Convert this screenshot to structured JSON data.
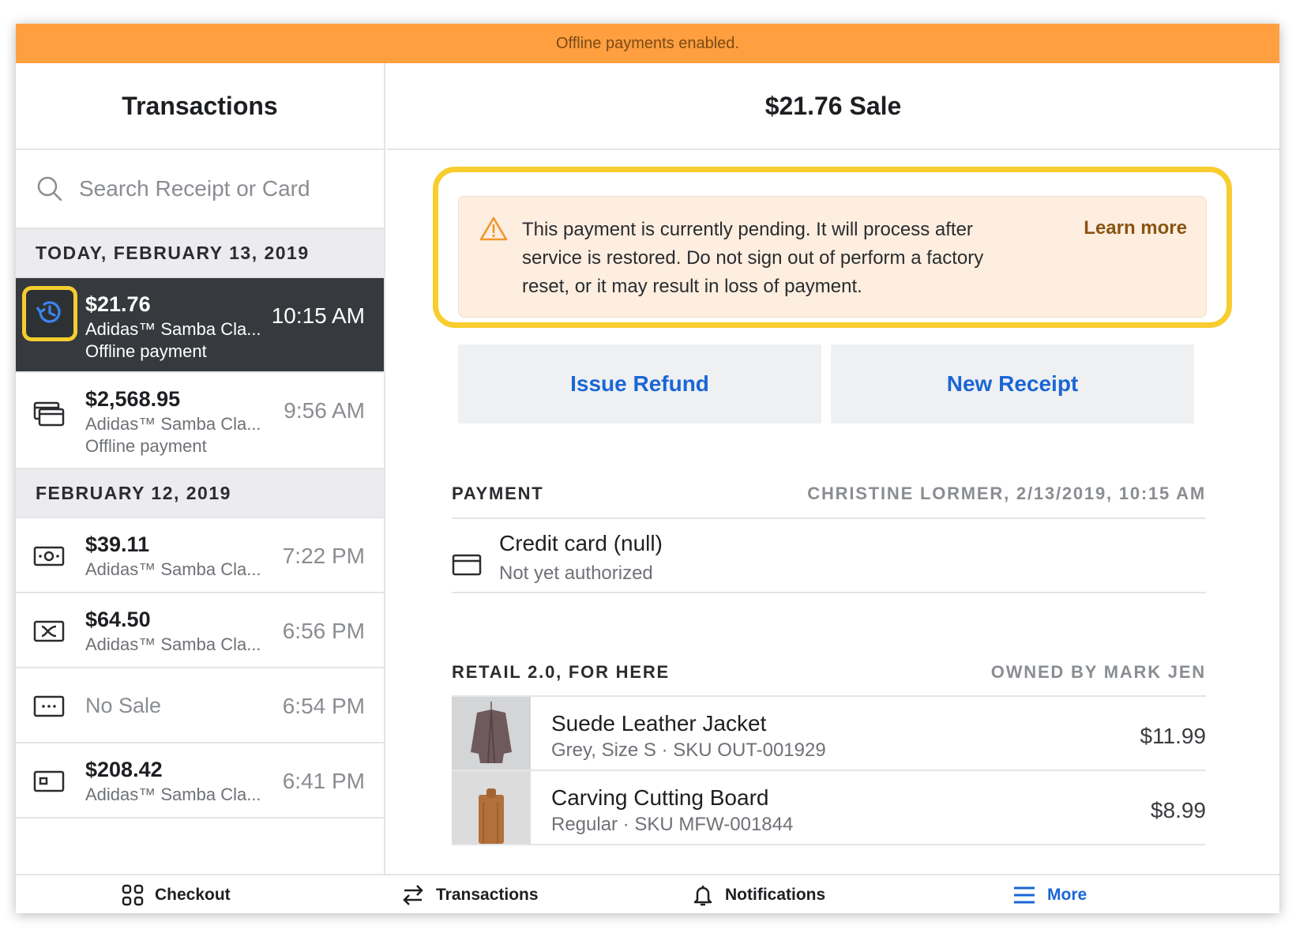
{
  "banner": {
    "text": "Offline payments enabled."
  },
  "left": {
    "title": "Transactions",
    "search_placeholder": "Search Receipt or Card",
    "sections": [
      {
        "label": "TODAY, FEBRUARY 13, 2019"
      },
      {
        "label": "FEBRUARY 12, 2019"
      }
    ],
    "transactions": [
      {
        "amount": "$21.76",
        "desc": "Adidas™ Samba Cla...",
        "sub": "Offline payment",
        "time": "10:15 AM",
        "icon": "history-icon",
        "selected": true
      },
      {
        "amount": "$2,568.95",
        "desc": "Adidas™ Samba Cla...",
        "sub": "Offline payment",
        "time": "9:56 AM",
        "icon": "cards-icon"
      },
      {
        "amount": "$39.11",
        "desc": "Adidas™ Samba Cla...",
        "time": "7:22 PM",
        "icon": "cash-icon"
      },
      {
        "amount": "$64.50",
        "desc": "Adidas™ Samba Cla...",
        "time": "6:56 PM",
        "icon": "gift-card-icon"
      },
      {
        "amount": "No Sale",
        "time": "6:54 PM",
        "icon": "ellipsis-card-icon"
      },
      {
        "amount": "$208.42",
        "desc": "Adidas™ Samba Cla...",
        "time": "6:41 PM",
        "icon": "card-chip-icon"
      }
    ]
  },
  "right": {
    "title": "$21.76 Sale",
    "alert": {
      "text": "This payment is currently pending. It will process after service is restored. Do not sign out of perform a factory reset, or it may result in loss of payment.",
      "link": "Learn more",
      "icon": "warning-icon"
    },
    "buttons": {
      "refund": "Issue Refund",
      "receipt": "New Receipt"
    },
    "payment": {
      "heading": "PAYMENT",
      "meta": "CHRISTINE LORMER, 2/13/2019, 10:15 AM",
      "method": "Credit card (null)",
      "status": "Not yet authorized"
    },
    "order": {
      "heading": "RETAIL 2.0, FOR HERE",
      "owner": "OWNED BY MARK JEN",
      "items": [
        {
          "name": "Suede Leather Jacket",
          "sub": "Grey, Size S · SKU OUT-001929",
          "price": "$11.99"
        },
        {
          "name": "Carving Cutting Board",
          "sub": "Regular · SKU MFW-001844",
          "price": "$8.99"
        }
      ]
    }
  },
  "nav": {
    "items": [
      {
        "label": "Checkout",
        "icon": "grid-icon"
      },
      {
        "label": "Transactions",
        "icon": "swap-arrows-icon"
      },
      {
        "label": "Notifications",
        "icon": "bell-icon"
      },
      {
        "label": "More",
        "icon": "menu-icon",
        "active": true
      }
    ]
  },
  "colors": {
    "banner": "#ff9f40",
    "accent": "#1a66d6",
    "highlight": "#f7cd2f",
    "selected_row": "#36393d",
    "alert_bg": "#fdeee0"
  }
}
